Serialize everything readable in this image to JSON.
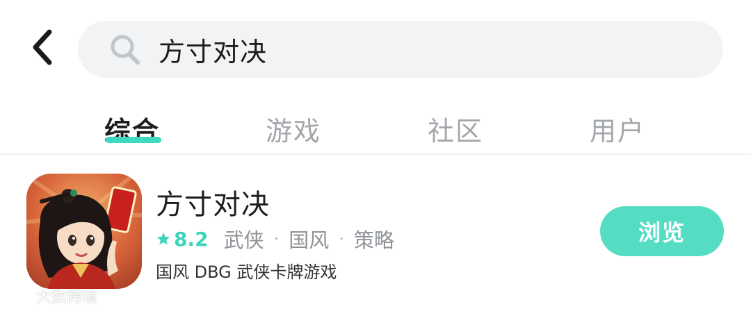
{
  "header": {
    "back_icon": "chevron-left-icon",
    "search_icon": "search-icon",
    "search_query": "方寸对决"
  },
  "tabs": [
    {
      "label": "综合",
      "active": true
    },
    {
      "label": "游戏",
      "active": false
    },
    {
      "label": "社区",
      "active": false
    },
    {
      "label": "用户",
      "active": false
    }
  ],
  "result": {
    "title": "方寸对决",
    "rating": "8.2",
    "tags": [
      "武侠",
      "国风",
      "策略"
    ],
    "separator": "·",
    "description": "国风 DBG 武侠卡牌游戏",
    "button_label": "浏览"
  },
  "watermark": {
    "text": "大数跨境"
  },
  "colors": {
    "accent": "#3fd9bf",
    "button_bg": "#55ddc4",
    "search_bg": "#f1f3f5",
    "inactive_tab": "#a3a7ab"
  }
}
